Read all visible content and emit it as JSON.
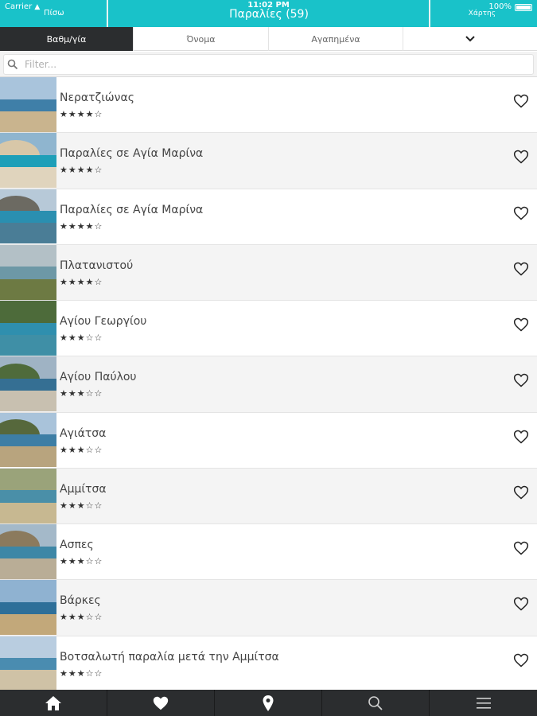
{
  "status": {
    "carrier": "Carrier",
    "time": "11:02 PM",
    "battery": "100%"
  },
  "navbar": {
    "back_label": "Πίσω",
    "title": "Παραλίες (59)",
    "map_label": "Χάρτης"
  },
  "tabs": [
    {
      "label": "Βαθμ/γία",
      "active": true
    },
    {
      "label": "Όνομα",
      "active": false
    },
    {
      "label": "Αγαπημένα",
      "active": false
    }
  ],
  "filter": {
    "placeholder": "Filter..."
  },
  "beaches": [
    {
      "name": "Νερατζιώνας",
      "stars": "★★★★☆",
      "rating": 4
    },
    {
      "name": "Παραλίες σε Αγία Μαρίνα",
      "stars": "★★★★☆",
      "rating": 4
    },
    {
      "name": "Παραλίες σε Αγία Μαρίνα",
      "stars": "★★★★☆",
      "rating": 4
    },
    {
      "name": "Πλατανιστού",
      "stars": "★★★★☆",
      "rating": 4
    },
    {
      "name": "Αγίου Γεωργίου",
      "stars": "★★★☆☆",
      "rating": 3
    },
    {
      "name": "Αγίου Παύλου",
      "stars": "★★★☆☆",
      "rating": 3
    },
    {
      "name": "Αγιάτσα",
      "stars": "★★★☆☆",
      "rating": 3
    },
    {
      "name": "Αμμίτσα",
      "stars": "★★★☆☆",
      "rating": 3
    },
    {
      "name": "Ασπες",
      "stars": "★★★☆☆",
      "rating": 3
    },
    {
      "name": "Βάρκες",
      "stars": "★★★☆☆",
      "rating": 3
    },
    {
      "name": "Βοτσαλωτή παραλία μετά την Αμμίτσα",
      "stars": "★★★☆☆",
      "rating": 3
    }
  ],
  "bottom_nav": [
    "home-icon",
    "heart-icon",
    "map-pin-icon",
    "search-icon",
    "menu-icon"
  ],
  "colors": {
    "accent": "#19c2c9",
    "dark": "#2b2d2f"
  }
}
